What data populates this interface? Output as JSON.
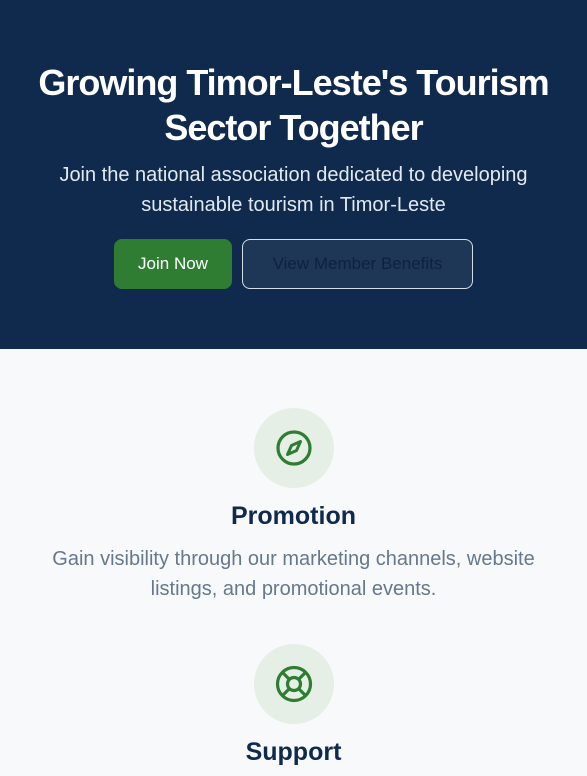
{
  "hero": {
    "title_line1": "Growing Timor-Leste's Tourism",
    "title_line2": "Sector Together",
    "subtitle_line1": "Join the national association dedicated to developing",
    "subtitle_line2": "sustainable tourism in Timor-Leste",
    "primary_button": "Join Now",
    "secondary_button": "View Member Benefits"
  },
  "features": [
    {
      "icon": "compass-icon",
      "title": "Promotion",
      "desc_line1": "Gain visibility through our marketing channels, website",
      "desc_line2": "listings, and promotional events."
    },
    {
      "icon": "lifebuoy-icon",
      "title": "Support"
    }
  ],
  "colors": {
    "hero_bg": "#0f2a4d",
    "accent_green": "#2e7d32",
    "page_bg": "#f7f9fb",
    "icon_bg": "#e5efe5"
  }
}
